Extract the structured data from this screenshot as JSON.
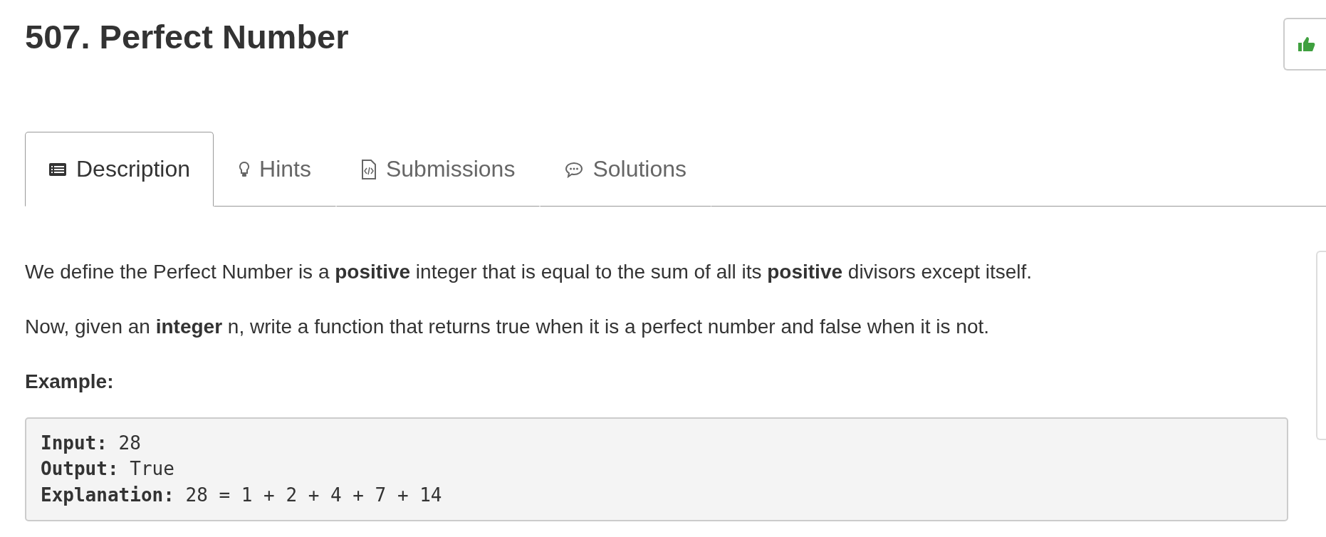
{
  "title": "507. Perfect Number",
  "tabs": [
    {
      "label": "Description",
      "kind": "list",
      "selected": true
    },
    {
      "label": "Hints",
      "kind": "bulb",
      "selected": false
    },
    {
      "label": "Submissions",
      "kind": "file",
      "selected": false
    },
    {
      "label": "Solutions",
      "kind": "chat",
      "selected": false
    }
  ],
  "paragraphs": [
    "We define the Perfect Number is a **positive** integer that is equal to the sum of all its **positive** divisors except itself.",
    "Now, given an **integer** n, write a function that returns true when it is a perfect number and false when it is not."
  ],
  "example_heading": "Example:",
  "example_lines": [
    {
      "label": "Input:",
      "value": "28"
    },
    {
      "label": "Output:",
      "value": "True"
    },
    {
      "label": "Explanation:",
      "value": "28 = 1 + 2 + 4 + 7 + 14"
    }
  ]
}
